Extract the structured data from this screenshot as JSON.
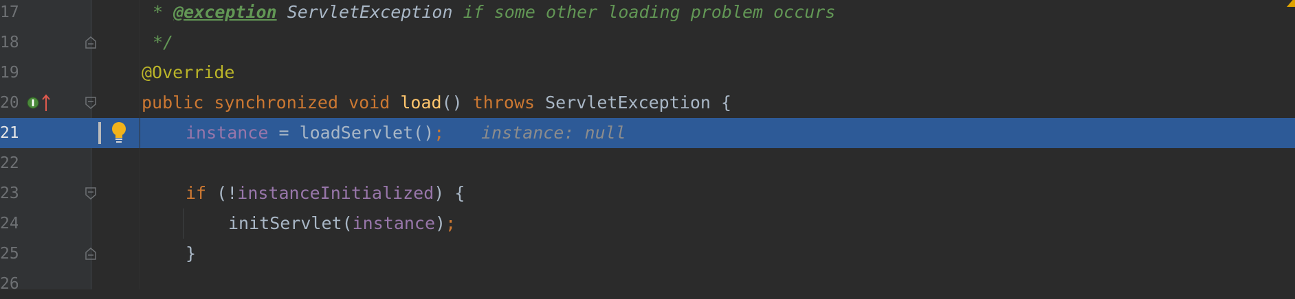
{
  "editor": {
    "lines": [
      {
        "num": "17",
        "kind": "doc-exception",
        "star": "* ",
        "tag": "@exception",
        "space1": " ",
        "ref": "ServletException",
        "rest": " if some other loading problem occurs"
      },
      {
        "num": "18",
        "kind": "doc-end",
        "text": "*/"
      },
      {
        "num": "19",
        "kind": "annotation",
        "text": "@Override"
      },
      {
        "num": "20",
        "kind": "signature",
        "kw1": "public",
        "kw2": "synchronized",
        "kw3": "void",
        "name": "load",
        "paren": "()",
        "kw4": "throws",
        "type": "ServletException",
        "brace": "{"
      },
      {
        "num": "21",
        "kind": "assignment",
        "field": "instance",
        "op": " = ",
        "call": "loadServlet()",
        "semi": ";",
        "hint": "instance: null"
      },
      {
        "num": "22",
        "kind": "blank"
      },
      {
        "num": "23",
        "kind": "if",
        "kw": "if",
        "open": " (!",
        "field": "instanceInitialized",
        "close": ") {"
      },
      {
        "num": "24",
        "kind": "call",
        "call": "initServlet(",
        "field": "instance",
        "close": ")",
        "semi": ";"
      },
      {
        "num": "25",
        "kind": "close",
        "text": "}"
      },
      {
        "num": "26",
        "kind": "blank"
      }
    ],
    "current_line": "21",
    "icons": {
      "implements_marker": "implements-method-icon",
      "override_arrow": "override-up-arrow-icon",
      "intention_bulb": "lightbulb-icon",
      "fold_marker": "fold-icon",
      "warning": "warning-triangle-icon"
    },
    "colors": {
      "background": "#2b2b2b",
      "selection": "#2d5a97",
      "keyword": "#cc7832",
      "function": "#ffc66d",
      "field": "#9876aa",
      "annotation": "#bbb529",
      "doc_comment": "#629755"
    }
  }
}
